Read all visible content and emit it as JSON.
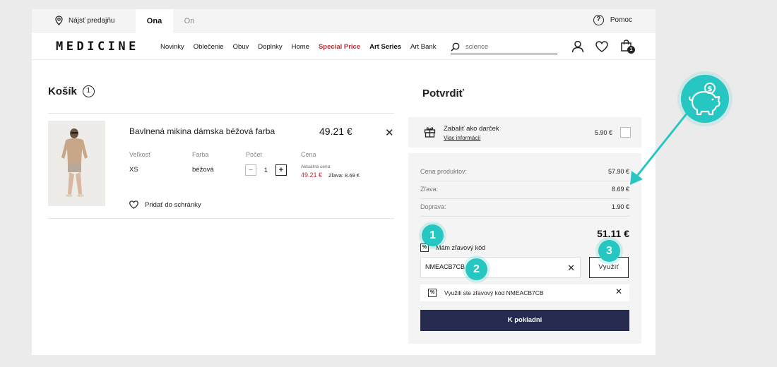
{
  "topbar": {
    "find_store": "Nájsť predajňu",
    "tabs": [
      {
        "label": "Ona",
        "active": true
      },
      {
        "label": "On",
        "active": false
      }
    ],
    "help": "Pomoc",
    "help_icon": "question-circle-icon"
  },
  "navbar": {
    "logo": "MEDICINE",
    "items": [
      "Novinky",
      "Oblečenie",
      "Obuv",
      "Doplnky",
      "Home",
      "Special Price",
      "Art Series",
      "Art Bank"
    ],
    "search_value": "science",
    "cart_count": "1"
  },
  "cart": {
    "title": "Košík",
    "count": "1",
    "product": {
      "name": "Bavlnená mikina dámska béžová farba",
      "price": "49.21 €",
      "size_label": "Veľkosť",
      "size_value": "XS",
      "color_label": "Farba",
      "color_value": "béžová",
      "qty_label": "Počet",
      "qty_minus": "−",
      "qty_value": "1",
      "qty_plus": "+",
      "price_label": "Cena",
      "current_price_label": "Aktuálna cena:",
      "current_price": "49.21 €",
      "discount": "Zľava: 8.69 €",
      "remove": "✕"
    },
    "wishlist": "Pridať do schránky"
  },
  "summary": {
    "title": "Potvrdiť",
    "gift_title": "Zabaliť ako darček",
    "gift_link": "Viac informácií",
    "gift_price": "5.90 €",
    "rows": [
      {
        "label": "Cena produktov:",
        "value": "57.90 €"
      },
      {
        "label": "Zľava:",
        "value": "8.69 €"
      },
      {
        "label": "Doprava:",
        "value": "1.90 €"
      }
    ],
    "total": "51.11 €",
    "code_toggle": "Mám zľavový kód",
    "code_value": "NMEACB7CB",
    "code_clear": "✕",
    "apply": "Využiť",
    "applied_msg": "Využili ste zľavový kód NMEACB7CB",
    "applied_close": "✕",
    "checkout": "K pokladni"
  },
  "annotations": {
    "one": "1",
    "two": "2",
    "three": "3"
  },
  "colors": {
    "accent": "#26c6c3",
    "special": "#b0333a",
    "checkout": "#242b4f"
  }
}
